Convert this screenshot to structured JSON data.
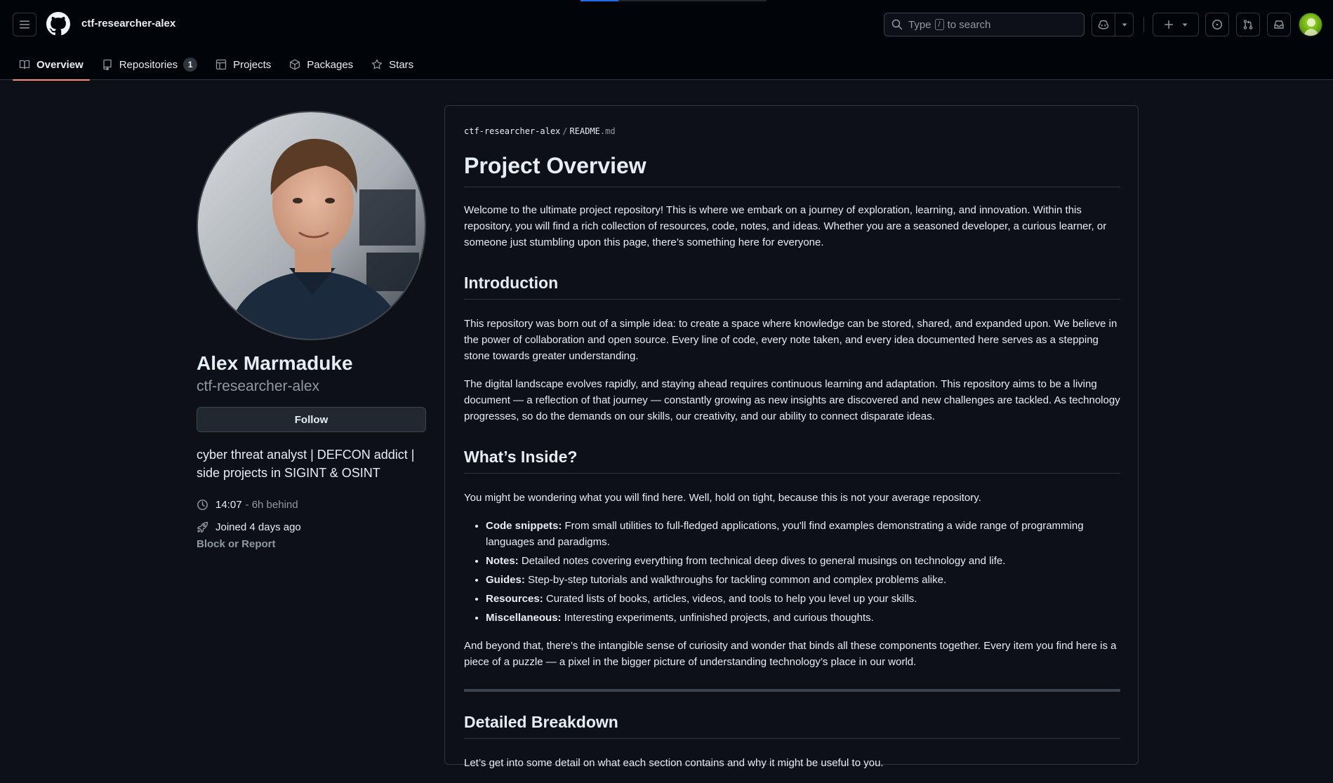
{
  "header": {
    "owner": "ctf-researcher-alex",
    "search": {
      "prefix": "Type",
      "key": "/",
      "suffix": "to search"
    }
  },
  "tabs": [
    {
      "label": "Overview",
      "icon": "book-icon"
    },
    {
      "label": "Repositories",
      "icon": "repo-icon",
      "count": "1"
    },
    {
      "label": "Projects",
      "icon": "table-icon"
    },
    {
      "label": "Packages",
      "icon": "package-icon"
    },
    {
      "label": "Stars",
      "icon": "star-icon"
    }
  ],
  "profile": {
    "name": "Alex Marmaduke",
    "login": "ctf-researcher-alex",
    "follow_label": "Follow",
    "bio": "cyber threat analyst | DEFCON addict | side projects in SIGINT & OSINT",
    "local_time": "14:07",
    "time_offset": "- 6h behind",
    "joined": "Joined 4 days ago",
    "block_label": "Block or Report"
  },
  "readme": {
    "crumb_owner": "ctf-researcher-alex",
    "crumb_sep": "/",
    "crumb_file": "README",
    "crumb_ext": ".md",
    "title": "Project Overview",
    "intro": "Welcome to the ultimate project repository! This is where we embark on a journey of exploration, learning, and innovation. Within this repository, you will find a rich collection of resources, code, notes, and ideas. Whether you are a seasoned developer, a curious learner, or someone just stumbling upon this page, there’s something here for everyone.",
    "h_introduction": "Introduction",
    "p_introduction_1": "This repository was born out of a simple idea: to create a space where knowledge can be stored, shared, and expanded upon. We believe in the power of collaboration and open source. Every line of code, every note taken, and every idea documented here serves as a stepping stone towards greater understanding.",
    "p_introduction_2": "The digital landscape evolves rapidly, and staying ahead requires continuous learning and adaptation. This repository aims to be a living document — a reflection of that journey — constantly growing as new insights are discovered and new challenges are tackled. As technology progresses, so do the demands on our skills, our creativity, and our ability to connect disparate ideas.",
    "h_inside": "What’s Inside?",
    "p_inside": "You might be wondering what you will find here. Well, hold on tight, because this is not your average repository.",
    "items": [
      {
        "term": "Code snippets:",
        "text": "From small utilities to full-fledged applications, you'll find examples demonstrating a wide range of programming languages and paradigms."
      },
      {
        "term": "Notes:",
        "text": "Detailed notes covering everything from technical deep dives to general musings on technology and life."
      },
      {
        "term": "Guides:",
        "text": "Step-by-step tutorials and walkthroughs for tackling common and complex problems alike."
      },
      {
        "term": "Resources:",
        "text": "Curated lists of books, articles, videos, and tools to help you level up your skills."
      },
      {
        "term": "Miscellaneous:",
        "text": "Interesting experiments, unfinished projects, and curious thoughts."
      }
    ],
    "p_beyond": "And beyond that, there’s the intangible sense of curiosity and wonder that binds all these components together. Every item you find here is a piece of a puzzle — a pixel in the bigger picture of understanding technology’s place in our world.",
    "h_breakdown": "Detailed Breakdown",
    "p_breakdown": "Let’s get into some detail on what each section contains and why it might be useful to you."
  },
  "colors": {
    "background": "#0d1117",
    "header_bg": "#010409",
    "border": "#30363d",
    "active_tab_underline": "#fd8c73",
    "muted_text": "#9198a1"
  }
}
